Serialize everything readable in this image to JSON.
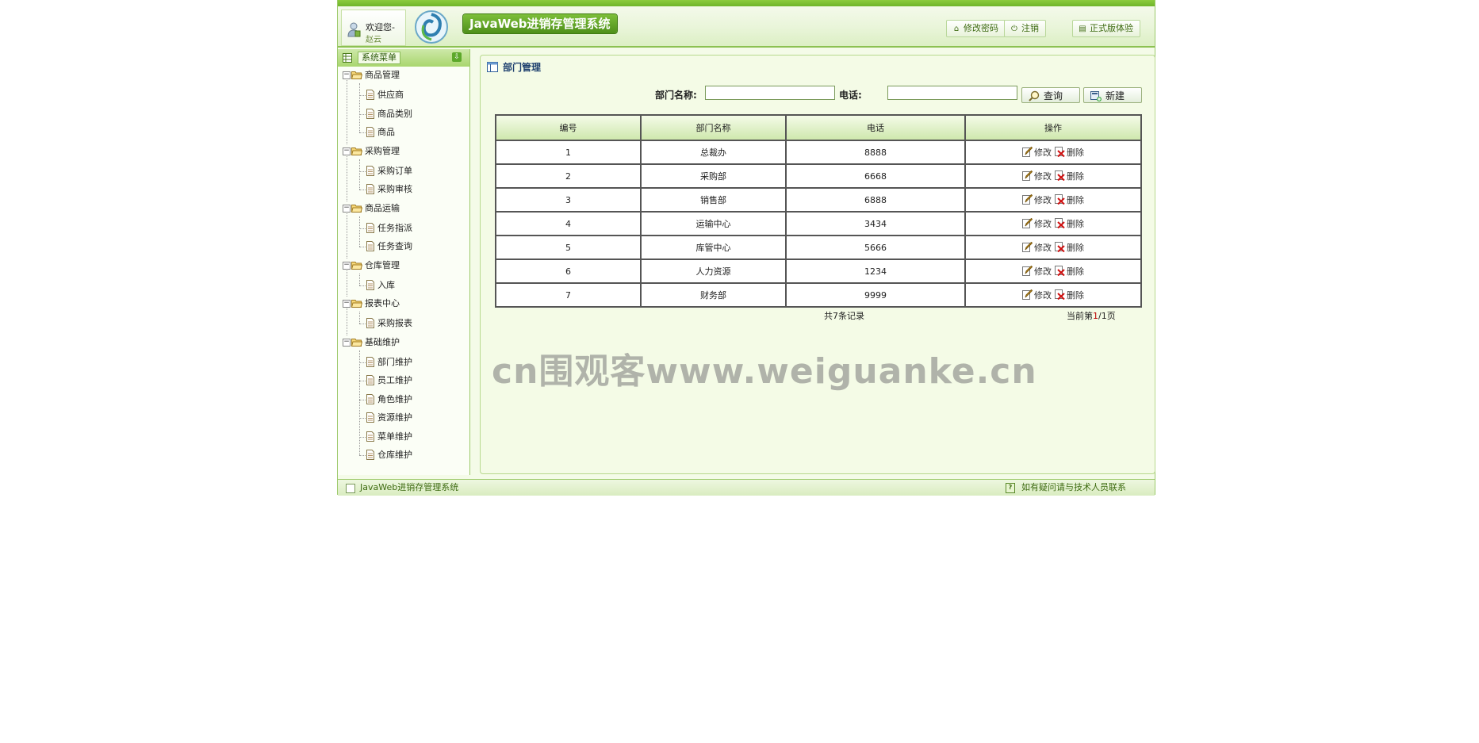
{
  "header": {
    "welcome_text": "欢迎您-",
    "user_name": "赵云",
    "app_title": "JavaWeb进销存管理系统",
    "buttons": {
      "change_password": "修改密码",
      "logout": "注销",
      "full_version": "正式版体验"
    }
  },
  "sidebar": {
    "title": "系统菜单",
    "groups": [
      {
        "label": "商品管理",
        "items": [
          "供应商",
          "商品类别",
          "商品"
        ]
      },
      {
        "label": "采购管理",
        "items": [
          "采购订单",
          "采购审核"
        ]
      },
      {
        "label": "商品运输",
        "items": [
          "任务指派",
          "任务查询"
        ]
      },
      {
        "label": "仓库管理",
        "items": [
          "入库"
        ]
      },
      {
        "label": "报表中心",
        "items": [
          "采购报表"
        ]
      },
      {
        "label": "基础维护",
        "items": [
          "部门维护",
          "员工维护",
          "角色维护",
          "资源维护",
          "菜单维护",
          "仓库维护"
        ]
      }
    ]
  },
  "main": {
    "title": "部门管理",
    "search": {
      "dept_name_label": "部门名称:",
      "dept_name_value": "",
      "phone_label": "电话:",
      "phone_value": "",
      "query_button": "查询",
      "new_button": "新建"
    },
    "table": {
      "headers": [
        "编号",
        "部门名称",
        "电话",
        "操作"
      ],
      "rows": [
        [
          "1",
          "总裁办",
          "8888"
        ],
        [
          "2",
          "采购部",
          "6668"
        ],
        [
          "3",
          "销售部",
          "6888"
        ],
        [
          "4",
          "运输中心",
          "3434"
        ],
        [
          "5",
          "库管中心",
          "5666"
        ],
        [
          "6",
          "人力资源",
          "1234"
        ],
        [
          "7",
          "财务部",
          "9999"
        ]
      ],
      "edit_label": "修改",
      "delete_label": "删除"
    },
    "record_info": "共7条记录",
    "page_info": {
      "prefix": "当前第",
      "current": "1",
      "separator": "/",
      "total": "1",
      "suffix": "页"
    }
  },
  "watermark": "cn围观客www.weiguanke.cn",
  "footer": {
    "left_text": "JavaWeb进销存管理系统",
    "right_text": "如有疑问请与技术人员联系"
  },
  "colors": {
    "accent_green": "#8cc152",
    "title_blue": "#1d3f6e",
    "page_current_red": "#bb0000"
  }
}
